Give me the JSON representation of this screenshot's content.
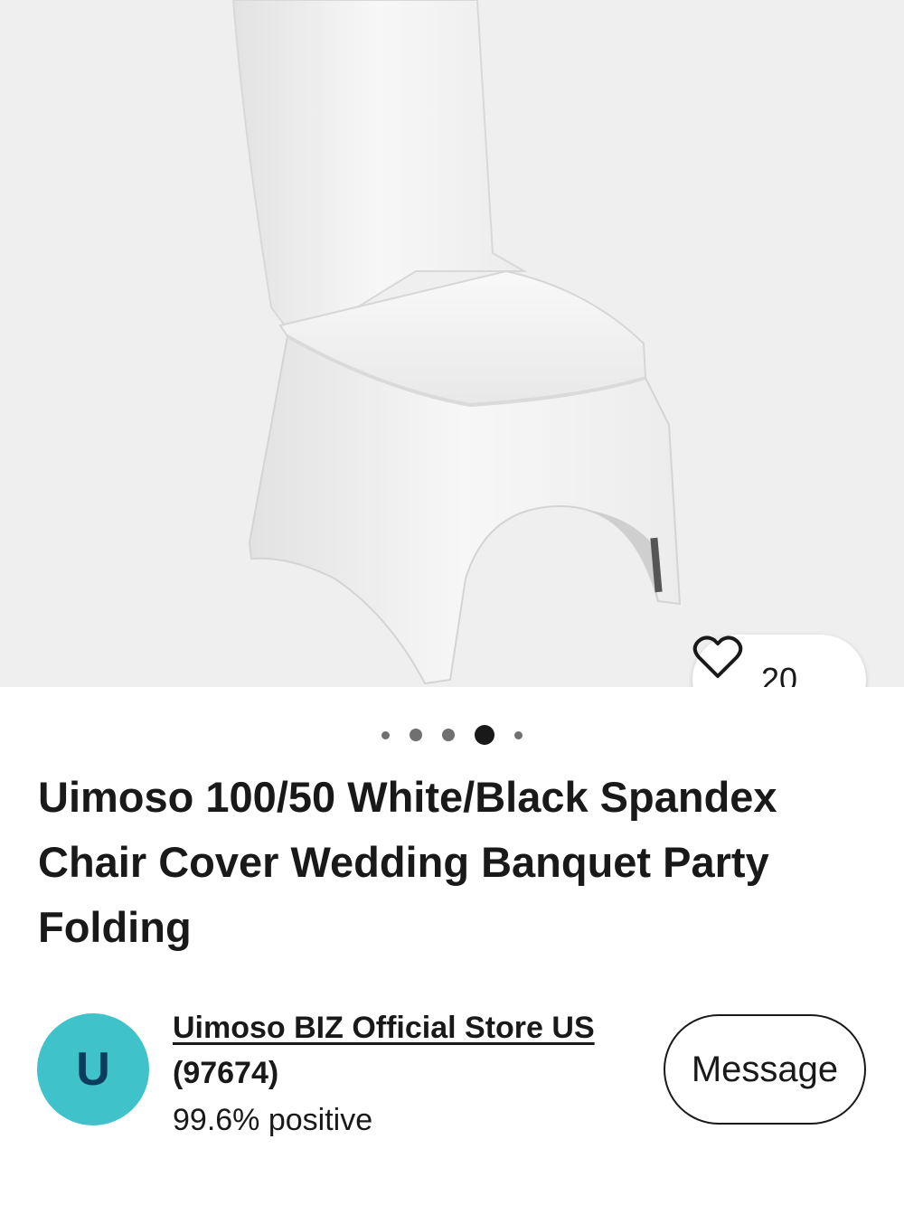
{
  "product": {
    "image_alt_icon": "chair-cover-photo",
    "carousel": {
      "total": 5,
      "active_index": 3
    },
    "watch_count": "20",
    "title": "Uimoso 100/50 White/Black Spandex Chair Cover Wedding Banquet Party Folding"
  },
  "seller": {
    "avatar_letter": "U",
    "avatar_color": "#3fc2c9",
    "name": "Uimoso BIZ Official Store US",
    "feedback_count": "(97674)",
    "positive": "99.6% positive"
  },
  "actions": {
    "message_label": "Message"
  }
}
